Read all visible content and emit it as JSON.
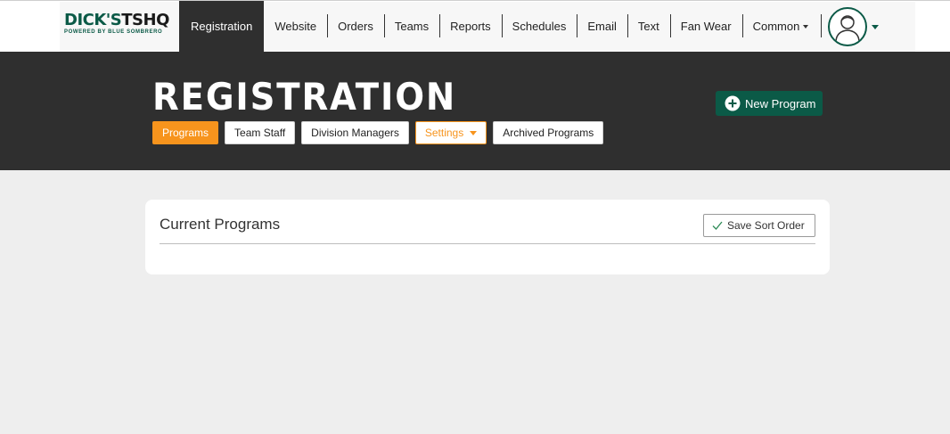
{
  "brand": {
    "logo_main": "DICK'S",
    "logo_accent": "TSHQ",
    "logo_sub": "POWERED BY BLUE SOMBRERO"
  },
  "nav": {
    "items": [
      {
        "label": "Registration",
        "active": true
      },
      {
        "label": "Website"
      },
      {
        "label": "Orders"
      },
      {
        "label": "Teams"
      },
      {
        "label": "Reports"
      },
      {
        "label": "Schedules"
      },
      {
        "label": "Email"
      },
      {
        "label": "Text"
      },
      {
        "label": "Fan Wear"
      },
      {
        "label": "Common",
        "dropdown": true
      }
    ],
    "user_icon": "user-avatar-icon"
  },
  "header": {
    "title": "REGISTRATION",
    "new_program_label": "New Program",
    "tabs": [
      {
        "label": "Programs",
        "active": true
      },
      {
        "label": "Team Staff"
      },
      {
        "label": "Division Managers"
      },
      {
        "label": "Settings",
        "dropdown": true
      },
      {
        "label": "Archived Programs"
      }
    ]
  },
  "card": {
    "title": "Current Programs",
    "save_sort_label": "Save Sort Order"
  },
  "colors": {
    "brand_green": "#0b5a47",
    "accent_orange": "#f7941d",
    "dark_band": "#2f2f2f",
    "page_bg": "#eeeeee"
  }
}
